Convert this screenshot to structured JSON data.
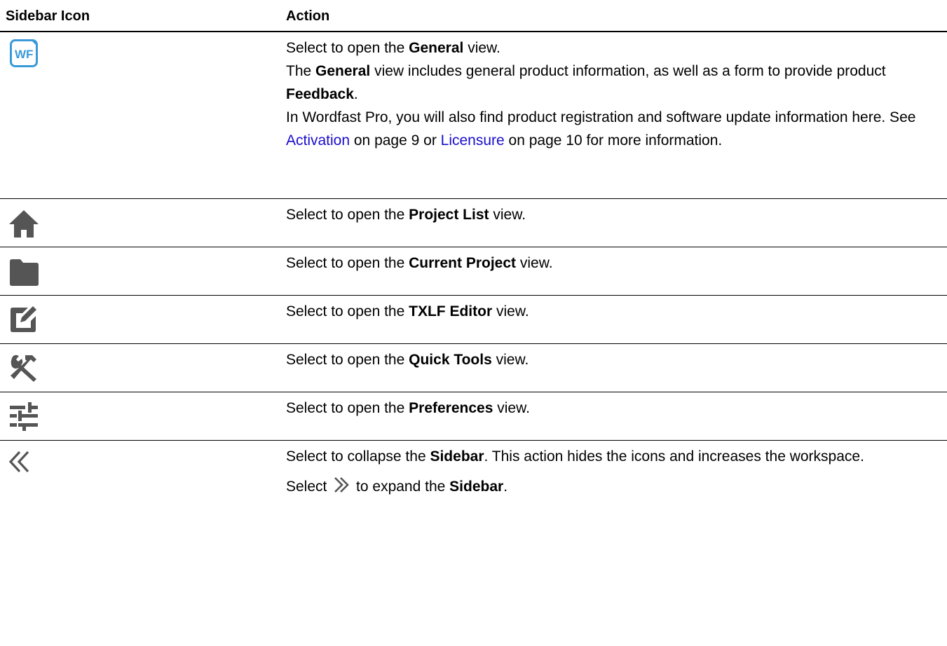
{
  "header": {
    "col_icon": "Sidebar Icon",
    "col_action": "Action"
  },
  "rows": [
    {
      "icon": "wordfast-general-icon",
      "wf_text": "WF",
      "lines": [
        {
          "a": "Select to open the ",
          "b": "General",
          "c": " view."
        },
        {
          "a": "The ",
          "b": "General",
          "c": " view includes general product information, as well as a form to provide product ",
          "d": "Feedback",
          "e": "."
        },
        {
          "a": "In Wordfast Pro, you will also find product registration and software update information here. See ",
          "link1": "Activation",
          "b": " on page 9 or ",
          "link2": "Licensure",
          "c": " on page 10 for more information."
        }
      ]
    },
    {
      "icon": "home-icon",
      "pre": "Select to open the ",
      "bold": "Project List",
      "post": " view."
    },
    {
      "icon": "folder-icon",
      "pre": "Select to open the ",
      "bold": "Current Project",
      "post": " view."
    },
    {
      "icon": "edit-icon",
      "pre": "Select to open the ",
      "bold": "TXLF Editor",
      "post": " view."
    },
    {
      "icon": "tools-icon",
      "pre": "Select to open the ",
      "bold": "Quick Tools",
      "post": " view."
    },
    {
      "icon": "sliders-icon",
      "pre": "Select to open the ",
      "bold": "Preferences",
      "post": " view."
    },
    {
      "icon": "collapse-chevrons-icon",
      "pre": "Select to collapse the ",
      "bold": "Sidebar",
      "post": ". This action hides the icons and increases the workspace.",
      "expand_pre": "Select ",
      "expand_icon": "expand-chevrons-icon",
      "expand_mid": " to expand the ",
      "expand_bold": "Sidebar",
      "expand_post": "."
    }
  ],
  "colors": {
    "icon_gray": "#555555",
    "wf_blue": "#3a9ad9",
    "link_blue": "#1a0dcc"
  }
}
